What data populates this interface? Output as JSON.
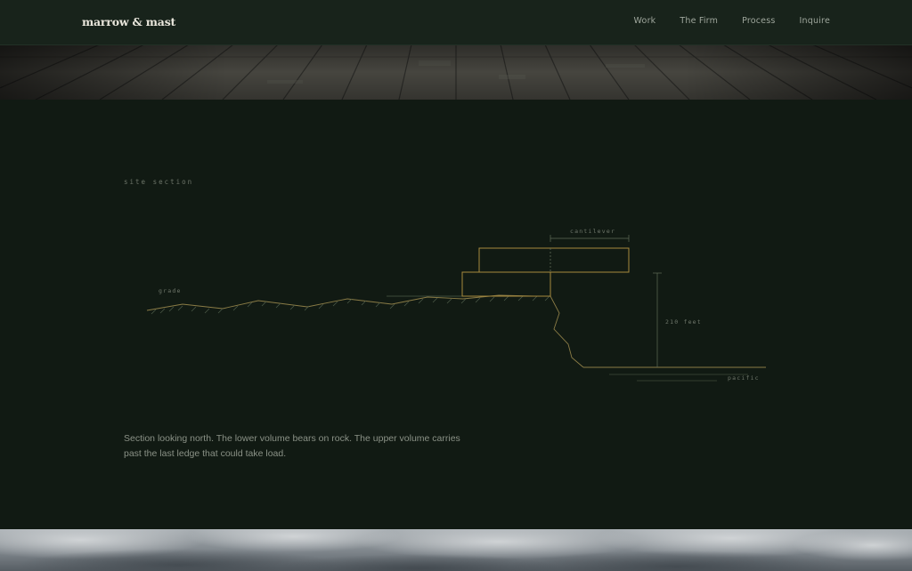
{
  "header": {
    "logo": "marrow & mast",
    "nav": [
      {
        "label": "Work"
      },
      {
        "label": "The Firm"
      },
      {
        "label": "Process"
      },
      {
        "label": "Inquire"
      }
    ]
  },
  "section": {
    "eyebrow": "site section",
    "labels": {
      "cantilever": "cantilever",
      "grade": "grade",
      "height": "210 feet",
      "water": "pacific"
    },
    "caption": "Section looking north. The lower volume bears on rock. The upper volume carries past the last ledge that could take load."
  },
  "colors": {
    "background": "#111a13",
    "header": "#18231b",
    "accent_gold": "#a88a3e",
    "line_muted": "#5e6a58"
  }
}
